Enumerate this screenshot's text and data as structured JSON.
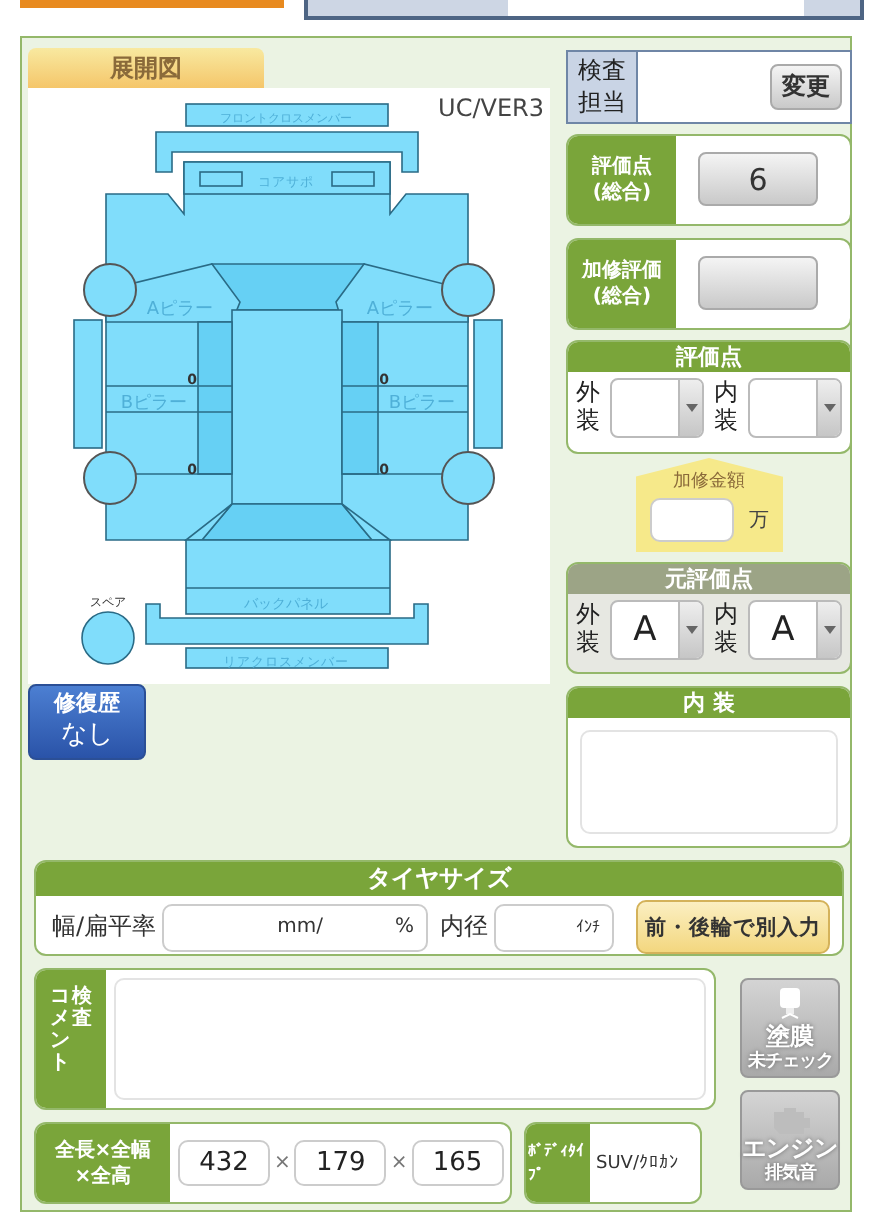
{
  "diagram": {
    "tab": "展開図",
    "version": "UC/VER3",
    "parts": [
      {
        "kind": "front_cross",
        "label": "フロントクロスメンバー"
      },
      {
        "kind": "core_support",
        "label": "コアサポ"
      },
      {
        "kind": "a_pillar_left",
        "label": "Aピラー"
      },
      {
        "kind": "a_pillar_right",
        "label": "Aピラー"
      },
      {
        "kind": "b_pillar_left",
        "label": "Bピラー"
      },
      {
        "kind": "b_pillar_right",
        "label": "Bピラー"
      },
      {
        "kind": "door_fl",
        "label": "0"
      },
      {
        "kind": "door_fr",
        "label": "0"
      },
      {
        "kind": "door_rl",
        "label": "0"
      },
      {
        "kind": "door_rr",
        "label": "0"
      },
      {
        "kind": "back_panel",
        "label": "バックパネル"
      },
      {
        "kind": "rear_cross",
        "label": "リアクロスメンバー"
      },
      {
        "kind": "spare",
        "label": "スペア"
      }
    ]
  },
  "repair_history": {
    "title": "修復歴",
    "value": "なし"
  },
  "inspector": {
    "label": "検査担当",
    "button": "変更"
  },
  "overall_score": {
    "label_lines": [
      "評価点",
      "(総合)"
    ],
    "value": "6"
  },
  "repair_score": {
    "label_lines": [
      "加修評価",
      "(総合)"
    ]
  },
  "score": {
    "title": "評価点",
    "fields": [
      {
        "label": "外装"
      },
      {
        "label": "内装"
      }
    ]
  },
  "repair_cost": {
    "label": "加修金額",
    "unit": "万"
  },
  "original_score": {
    "title": "元評価点",
    "fields": [
      {
        "label": "外装",
        "value": "A"
      },
      {
        "label": "内装",
        "value": "A"
      }
    ]
  },
  "interior": {
    "title": "内 装"
  },
  "tire": {
    "title": "タイヤサイズ",
    "width_label": "幅/扁平率",
    "width_unit": "mm/",
    "ratio_unit": "%",
    "diameter_label": "内径",
    "diameter_unit": "ｲﾝﾁ",
    "button": "前・後輪で別入力"
  },
  "comment": {
    "label_columns": [
      "コメント",
      "検査"
    ]
  },
  "side_buttons": [
    {
      "kind": "paint",
      "lines": [
        "塗膜",
        "未チェック"
      ]
    },
    {
      "kind": "engine",
      "lines": [
        "エンジン",
        "排気音"
      ]
    }
  ],
  "dimensions": {
    "label_lines": [
      "全長×全幅",
      "×全高"
    ],
    "values": [
      "432",
      "179",
      "165"
    ],
    "separators": [
      "×",
      "×"
    ]
  },
  "body_type": {
    "label": "ﾎﾞﾃﾞｨﾀｲﾌﾟ",
    "value": "SUV/ｸﾛｶﾝ"
  }
}
